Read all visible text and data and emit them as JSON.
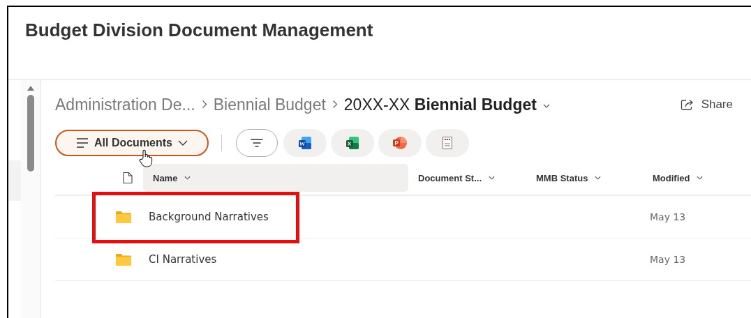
{
  "page_title": "Budget Division Document Management",
  "breadcrumb": [
    {
      "label": "Administration De...",
      "current": false
    },
    {
      "label": "Biennial Budget",
      "current": false
    },
    {
      "label": "20XX-XX **Biennial Budget**",
      "current": true
    }
  ],
  "share": {
    "label": "Share"
  },
  "view_button": {
    "label": "All Documents"
  },
  "quick_filters": [
    {
      "kind": "filter"
    },
    {
      "kind": "word"
    },
    {
      "kind": "excel"
    },
    {
      "kind": "powerpoint"
    },
    {
      "kind": "pdf"
    }
  ],
  "table": {
    "columns": [
      {
        "label": "Name",
        "highlighted": true
      },
      {
        "label": "Document St...",
        "highlighted": false
      },
      {
        "label": "MMB Status",
        "highlighted": false
      },
      {
        "label": "Modified",
        "highlighted": false
      }
    ],
    "rows": [
      {
        "kind": "folder",
        "name": "Background Narratives",
        "modified": "May 13",
        "annotated": true
      },
      {
        "kind": "folder",
        "name": "CI Narratives",
        "modified": "May 13",
        "annotated": false
      }
    ]
  }
}
